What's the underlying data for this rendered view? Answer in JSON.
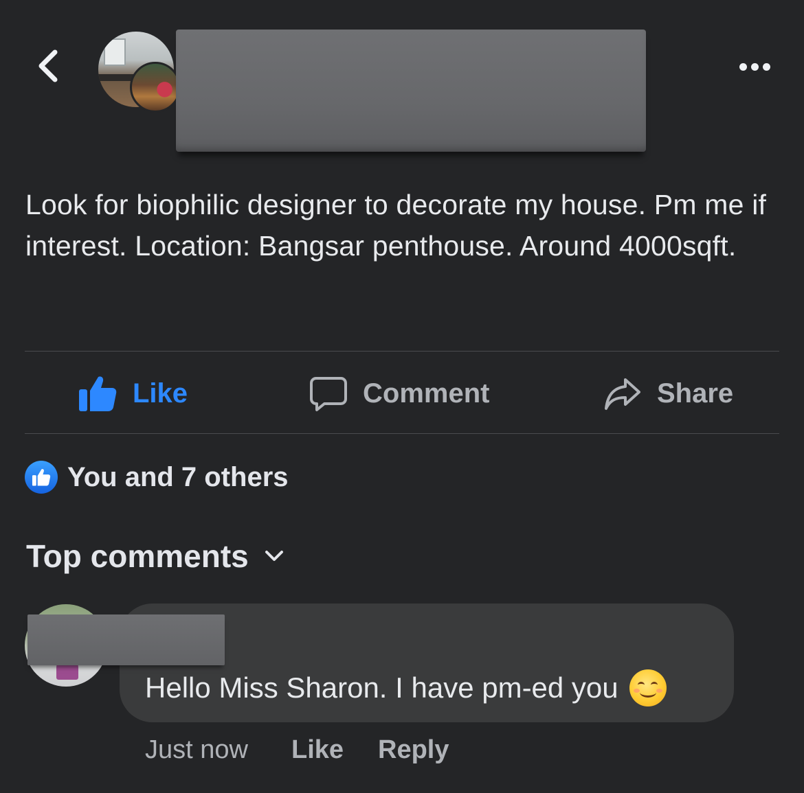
{
  "header": {
    "back_icon": "chevron-left-icon",
    "more_icon": "more-horizontal-icon"
  },
  "post": {
    "text": "Look for biophilic designer to decorate my house. Pm me if interest. Location: Bangsar penthouse. Around 4000sqft."
  },
  "actions": {
    "like_label": "Like",
    "comment_label": "Comment",
    "share_label": "Share",
    "like_color": "#2d88ff",
    "muted_color": "#b0b3b8"
  },
  "reactions": {
    "summary": "You and 7 others"
  },
  "comments_section": {
    "sort_label": "Top comments"
  },
  "comment": {
    "text": "Hello Miss Sharon. I have pm-ed you",
    "emoji_icon": "smiling-face-icon",
    "timestamp": "Just now",
    "like_label": "Like",
    "reply_label": "Reply"
  },
  "colors": {
    "background": "#242527",
    "bubble": "#3a3b3c",
    "text": "#e4e6eb"
  }
}
